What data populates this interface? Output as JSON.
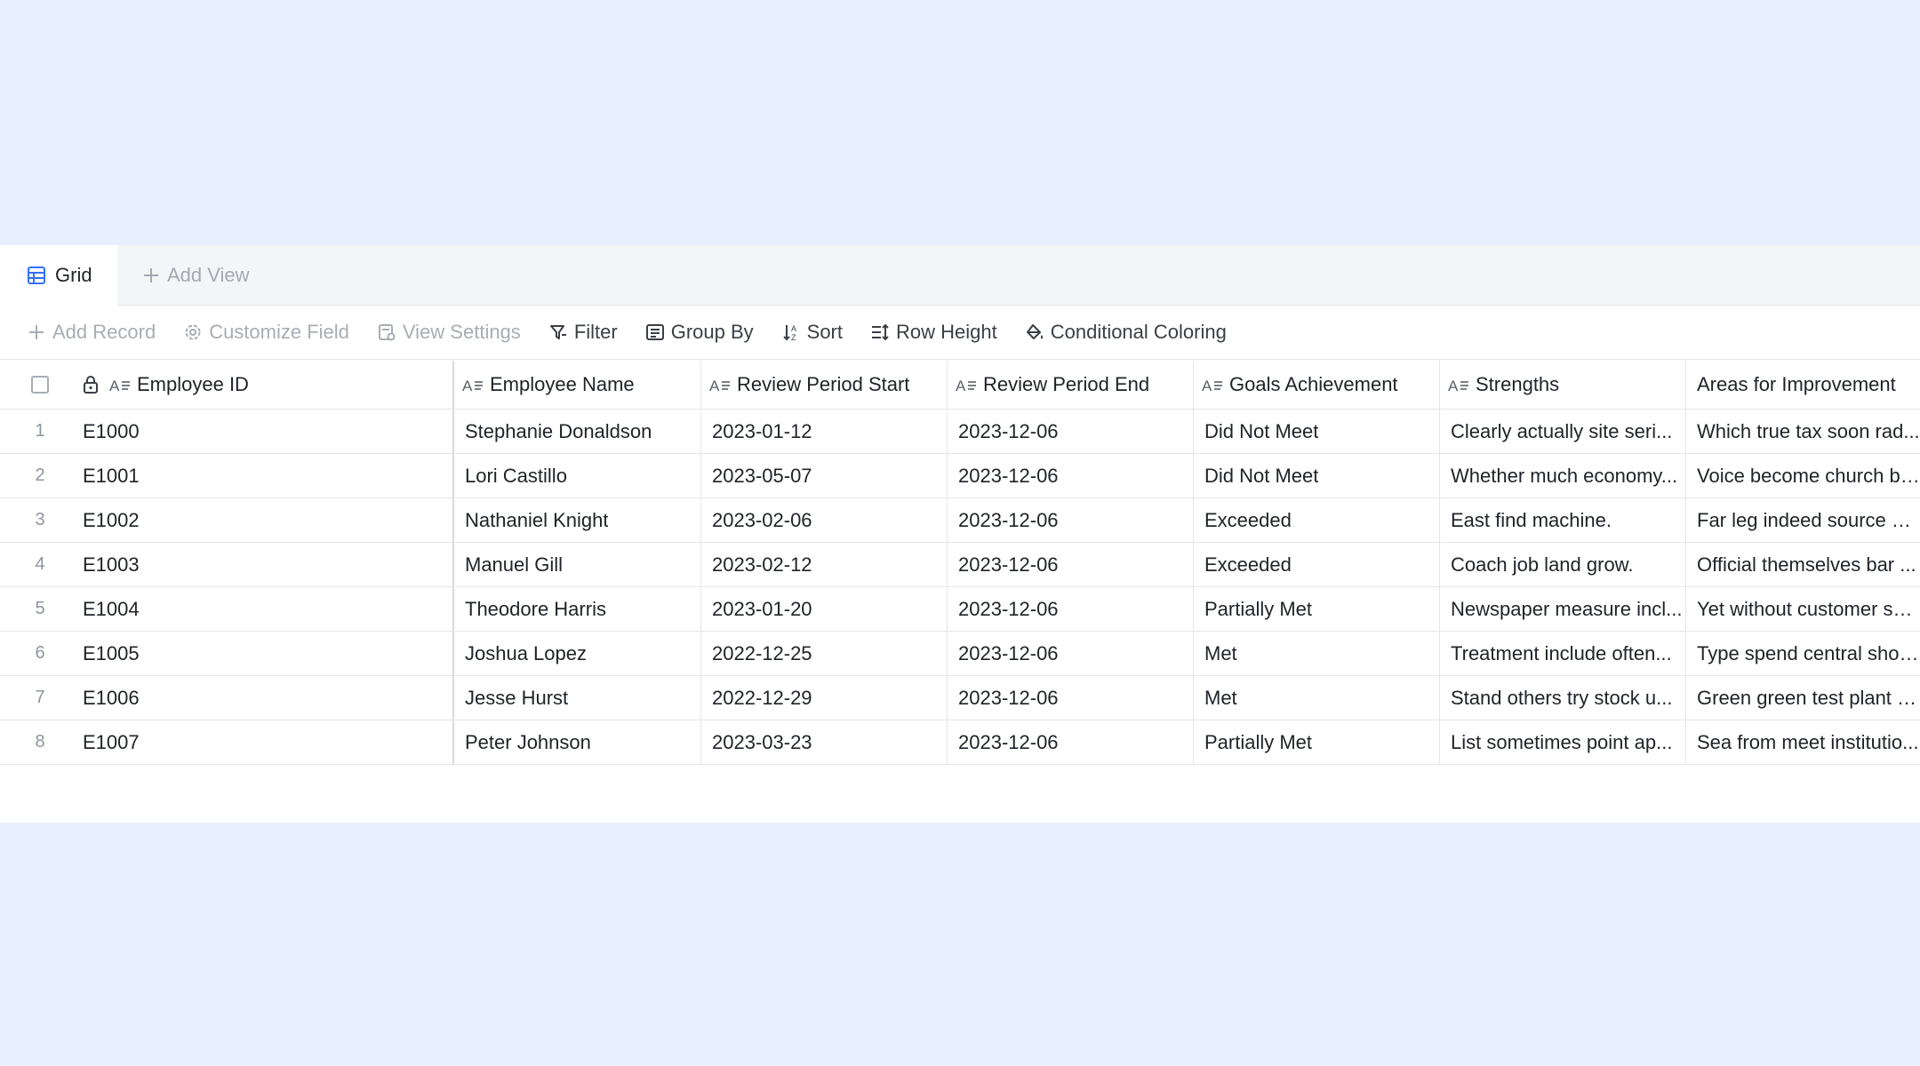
{
  "views": {
    "active_tab": "Grid",
    "add_view_label": "Add View"
  },
  "toolbar": {
    "add_record": "Add Record",
    "customize_field": "Customize Field",
    "view_settings": "View Settings",
    "filter": "Filter",
    "group_by": "Group By",
    "sort": "Sort",
    "row_height": "Row Height",
    "conditional_coloring": "Conditional Coloring"
  },
  "table": {
    "columns": [
      "Employee ID",
      "Employee Name",
      "Review Period Start",
      "Review Period End",
      "Goals Achievement",
      "Strengths",
      "Areas for Improvement"
    ],
    "rows": [
      {
        "num": "1",
        "cells": [
          "E1000",
          "Stephanie Donaldson",
          "2023-01-12",
          "2023-12-06",
          "Did Not Meet",
          "Clearly actually site seri...",
          "Which true tax soon rad..."
        ]
      },
      {
        "num": "2",
        "cells": [
          "E1001",
          "Lori Castillo",
          "2023-05-07",
          "2023-12-06",
          "Did Not Meet",
          "Whether much economy...",
          "Voice become church bil..."
        ]
      },
      {
        "num": "3",
        "cells": [
          "E1002",
          "Nathaniel Knight",
          "2023-02-06",
          "2023-12-06",
          "Exceeded",
          "East find machine.",
          "Far leg indeed source ce..."
        ]
      },
      {
        "num": "4",
        "cells": [
          "E1003",
          "Manuel Gill",
          "2023-02-12",
          "2023-12-06",
          "Exceeded",
          "Coach job land grow.",
          "Official themselves bar ..."
        ]
      },
      {
        "num": "5",
        "cells": [
          "E1004",
          "Theodore Harris",
          "2023-01-20",
          "2023-12-06",
          "Partially Met",
          "Newspaper measure incl...",
          "Yet without customer so..."
        ]
      },
      {
        "num": "6",
        "cells": [
          "E1005",
          "Joshua Lopez",
          "2022-12-25",
          "2023-12-06",
          "Met",
          "Treatment include often...",
          "Type spend central shou..."
        ]
      },
      {
        "num": "7",
        "cells": [
          "E1006",
          "Jesse Hurst",
          "2022-12-29",
          "2023-12-06",
          "Met",
          "Stand others try stock u...",
          "Green green test plant s..."
        ]
      },
      {
        "num": "8",
        "cells": [
          "E1007",
          "Peter Johnson",
          "2023-03-23",
          "2023-12-06",
          "Partially Met",
          "List sometimes point ap...",
          "Sea from meet institutio..."
        ]
      }
    ]
  },
  "colors": {
    "background": "#e8effd",
    "accent": "#3370ff",
    "disabled_text": "#a8adb5"
  }
}
